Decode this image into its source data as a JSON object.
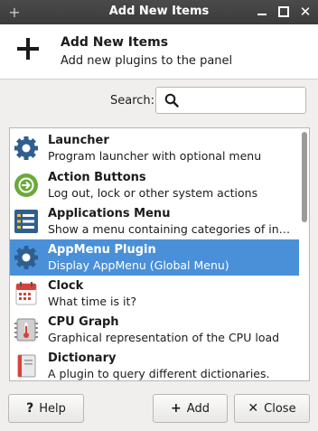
{
  "window": {
    "title": "Add New Items",
    "pin_icon": "plus-icon",
    "controls": [
      "minimize-icon",
      "maximize-icon",
      "close-icon"
    ]
  },
  "header": {
    "title": "Add New Items",
    "subtitle": "Add new plugins to the panel",
    "icon": "plus-icon"
  },
  "search": {
    "label": "Search:",
    "value": "",
    "icon": "search-icon"
  },
  "plugins": [
    {
      "name": "Launcher",
      "desc": "Program launcher with optional menu",
      "icon": "gear-icon",
      "selected": false
    },
    {
      "name": "Action Buttons",
      "desc": "Log out, lock or other system actions",
      "icon": "action-buttons-icon",
      "selected": false
    },
    {
      "name": "Applications Menu",
      "desc": "Show a menu containing categories of installe...",
      "icon": "applications-menu-icon",
      "selected": false
    },
    {
      "name": "AppMenu Plugin",
      "desc": "Display AppMenu (Global Menu)",
      "icon": "gear-icon",
      "selected": true
    },
    {
      "name": "Clock",
      "desc": "What time is it?",
      "icon": "calendar-clock-icon",
      "selected": false
    },
    {
      "name": "CPU Graph",
      "desc": "Graphical representation of the CPU load",
      "icon": "cpu-graph-icon",
      "selected": false
    },
    {
      "name": "Dictionary",
      "desc": "A plugin to query different dictionaries.",
      "icon": "dictionary-icon",
      "selected": false
    }
  ],
  "buttons": {
    "help": {
      "label": "Help",
      "icon": "help-icon"
    },
    "add": {
      "label": "Add",
      "icon": "plus-icon"
    },
    "close": {
      "label": "Close",
      "icon": "close-icon"
    }
  },
  "colors": {
    "selection": "#4a90d9",
    "titlebar": "#3f3f3f",
    "window_bg": "#f0efee"
  }
}
